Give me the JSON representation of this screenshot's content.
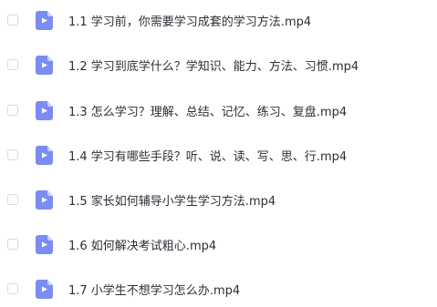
{
  "file_list": {
    "items": [
      {
        "name": "1.1 学习前，你需要学习成套的学习方法.mp4",
        "icon": "video-file-icon"
      },
      {
        "name": "1.2 学习到底学什么？学知识、能力、方法、习惯.mp4",
        "icon": "video-file-icon"
      },
      {
        "name": "1.3 怎么学习？理解、总结、记忆、练习、复盘.mp4",
        "icon": "video-file-icon"
      },
      {
        "name": "1.4 学习有哪些手段？听、说、读、写、思、行.mp4",
        "icon": "video-file-icon"
      },
      {
        "name": "1.5 家长如何辅导小学生学习方法.mp4",
        "icon": "video-file-icon"
      },
      {
        "name": "1.6 如何解决考试粗心.mp4",
        "icon": "video-file-icon"
      },
      {
        "name": "1.7 小学生不想学习怎么办.mp4",
        "icon": "video-file-icon"
      }
    ]
  },
  "colors": {
    "icon_fill": "#7b8cf4",
    "icon_fold": "#c9d0fb",
    "text": "#2b2f36",
    "checkbox_border": "#d6d9df"
  }
}
